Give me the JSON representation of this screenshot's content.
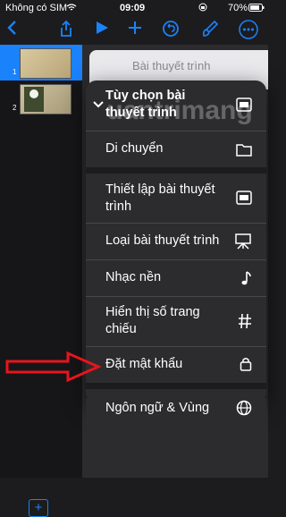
{
  "status": {
    "carrier": "Không có SIM",
    "time": "09:09",
    "battery": "70%"
  },
  "toolbar": {
    "back_icon": "chevron-left-icon",
    "share_icon": "share-icon",
    "play_icon": "play-icon",
    "add_icon": "plus-icon",
    "undo_icon": "undo-icon",
    "format_icon": "paintbrush-icon",
    "more_icon": "ellipsis-icon"
  },
  "sidebar": {
    "slides": [
      {
        "number": "1"
      },
      {
        "number": "2"
      }
    ],
    "add_icon": "plus-icon"
  },
  "background_title": "Bài thuyết trình",
  "menu": {
    "items": [
      {
        "label": "Tùy chọn bài thuyết trình",
        "icon": "presentation-icon"
      },
      {
        "label": "Di chuyển",
        "icon": "folder-icon"
      },
      {
        "label": "Thiết lập bài thuyết trình",
        "icon": "presentation-icon"
      },
      {
        "label": "Loại bài thuyết trình",
        "icon": "easel-icon"
      },
      {
        "label": "Nhạc nền",
        "icon": "music-note-icon"
      },
      {
        "label": "Hiển thị số trang chiếu",
        "icon": "hash-icon"
      },
      {
        "label": "Đặt mật khẩu",
        "icon": "lock-icon"
      },
      {
        "label": "Ngôn ngữ & Vùng",
        "icon": "globe-icon"
      }
    ]
  },
  "watermark": "uantrimang",
  "colors": {
    "accent": "#1a82fb",
    "arrow": "#e8141c"
  }
}
